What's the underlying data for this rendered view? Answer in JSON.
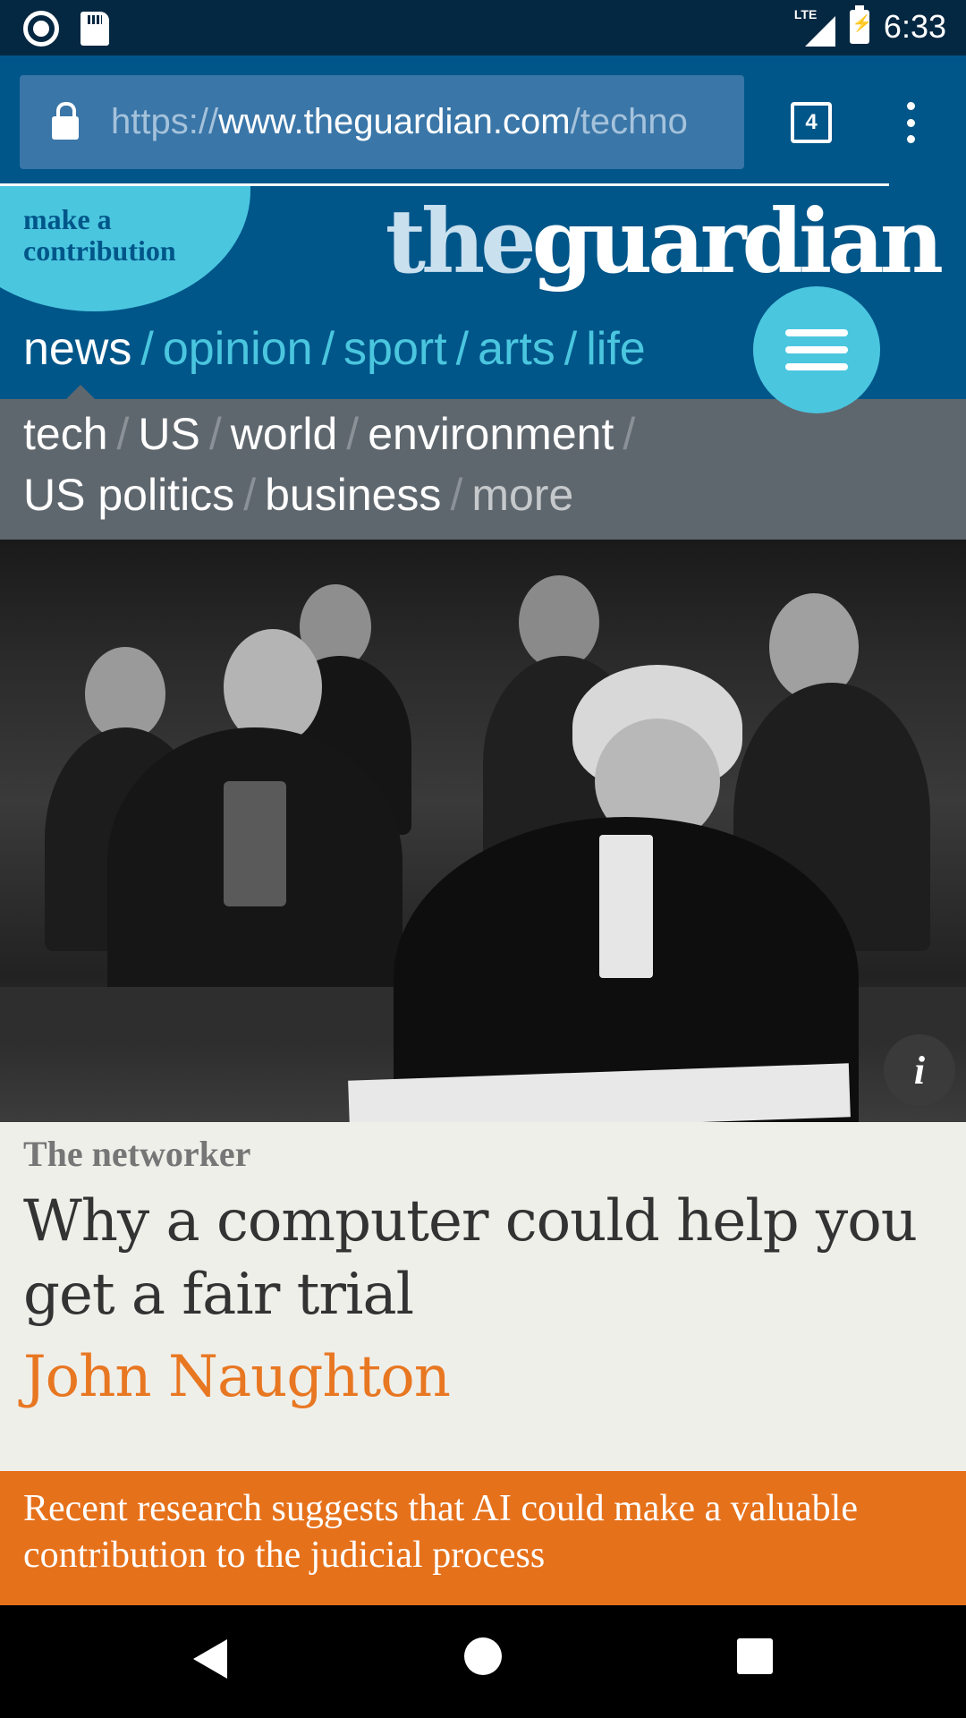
{
  "status_bar": {
    "network": "LTE",
    "time": "6:33",
    "icons": [
      "record-icon",
      "sd-card-icon",
      "signal-icon",
      "battery-charging-icon"
    ]
  },
  "browser": {
    "url_scheme": "https://",
    "url_host": "www.theguardian.com",
    "url_path": "/techno",
    "tab_count": "4",
    "page_load_progress": 0.92
  },
  "header": {
    "contribute_line1": "make a",
    "contribute_line2": "contribution",
    "logo_the": "the",
    "logo_guardian": "guardian",
    "pillars": {
      "news": "news",
      "opinion": "opinion",
      "sport": "sport",
      "arts": "arts",
      "life": "life"
    },
    "separator": "/"
  },
  "subnav": {
    "tech": "tech",
    "us": "US",
    "world": "world",
    "environment": "environment",
    "us_politics": "US politics",
    "business": "business",
    "more": "more"
  },
  "hero": {
    "info_label": "i"
  },
  "article": {
    "kicker": "The networker",
    "title": "Why a computer could help you get a fair trial",
    "byline": "John Naughton",
    "standfirst": "Recent research suggests that AI could make a valuable contribution to the judicial process"
  },
  "colors": {
    "brand_blue": "#005689",
    "accent_cyan": "#4bc6df",
    "subnav_grey": "#5f676e",
    "byline_orange": "#e87722",
    "standfirst_orange": "#e6711b"
  }
}
